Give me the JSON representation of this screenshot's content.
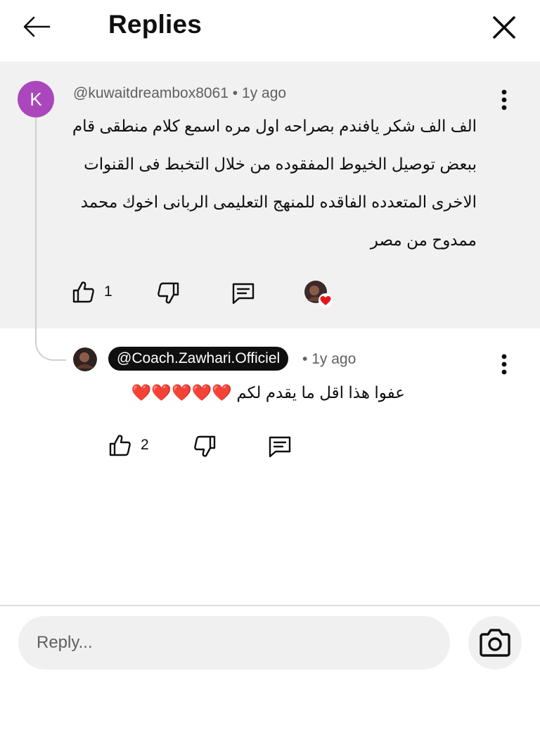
{
  "header": {
    "title": "Replies"
  },
  "parent_comment": {
    "avatar_letter": "K",
    "avatar_color": "#ab47bc",
    "handle": "@kuwaitdreambox8061",
    "separator": "•",
    "time": "1y ago",
    "text": "الف الف شكر يافندم بصراحه اول مره اسمع كلام منطقى قام ببعض توصيل الخيوط المفقوده من خلال التخبط فى القنوات الاخرى المتعدده الفاقده للمنهج التعليمى الربانى اخوك محمد ممدوح من مصر",
    "like_count": "1",
    "creator_heart": true
  },
  "reply": {
    "handle": "@Coach.Zawhari.Officiel",
    "separator": "•",
    "time": "1y ago",
    "text": "عفوا هذا اقل ما يقدم لكم",
    "hearts": "❤️❤️❤️❤️❤️",
    "like_count": "2"
  },
  "composer": {
    "placeholder": "Reply..."
  },
  "colors": {
    "heart": "#e8141c",
    "chip_bg": "#0f0f0f",
    "panel_bg": "#f1f1f1"
  }
}
